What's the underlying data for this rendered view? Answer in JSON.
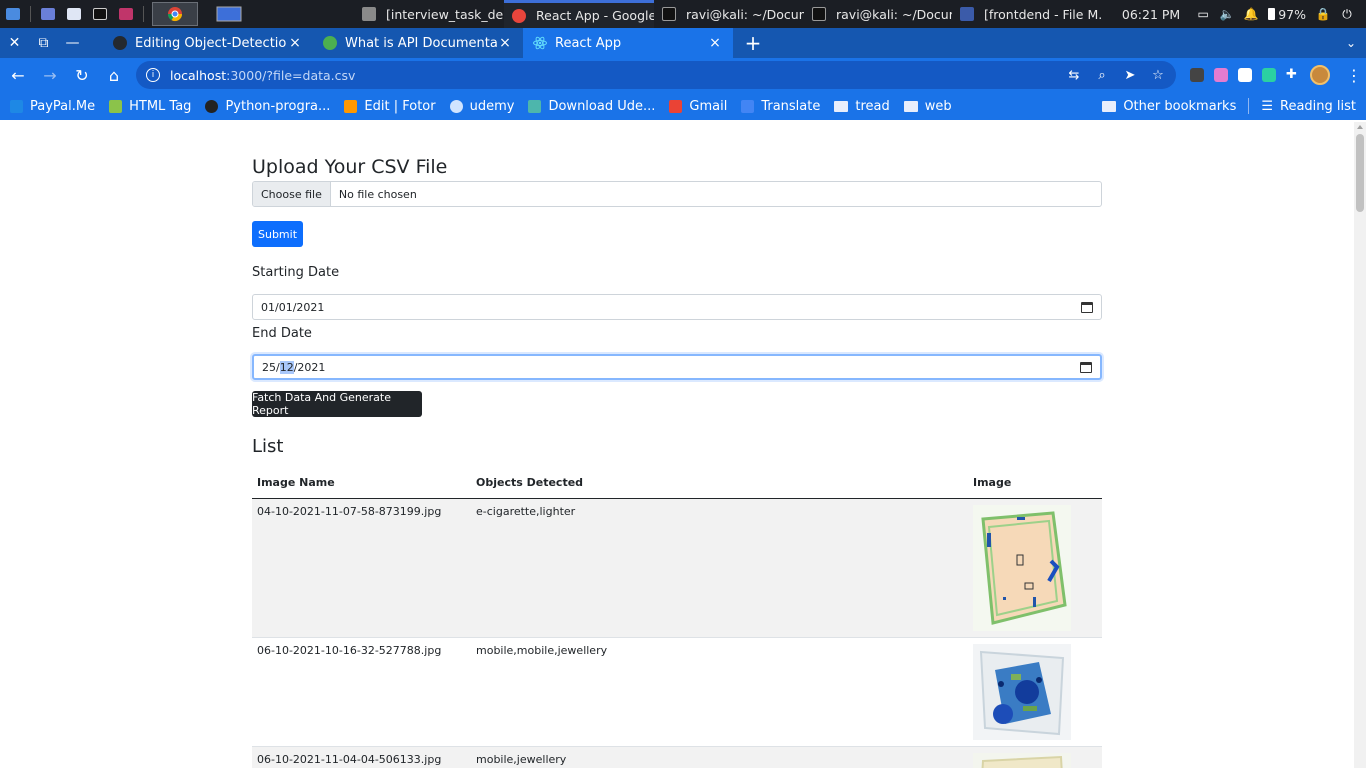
{
  "taskbar": {
    "tasks": [
      {
        "label": "[interview_task_de...",
        "color": "#8a8a8a"
      },
      {
        "label": "React App - Google...",
        "color": "#e8453c",
        "active": true
      },
      {
        "label": "ravi@kali: ~/Docum...",
        "color": "#333333"
      },
      {
        "label": "ravi@kali: ~/Docum...",
        "color": "#333333"
      },
      {
        "label": "[frontdend - File M...",
        "color": "#3b5ba9"
      }
    ],
    "time": "06:21 PM",
    "battery": "97%"
  },
  "browser": {
    "tabs": [
      {
        "label": "Editing Object-Detection/",
        "favicon_color": "#24292f",
        "close": "×"
      },
      {
        "label": "What is API Documentatio",
        "favicon_color": "#4caf50",
        "close": "×"
      },
      {
        "label": "React App",
        "favicon_color": "#61dafb",
        "close": "×",
        "active": true
      }
    ],
    "new_tab": "+",
    "url_host": "localhost",
    "url_rest": ":3000/?file=data.csv"
  },
  "bookmarks": {
    "items": [
      {
        "label": "PayPal.Me",
        "color": "#1e88e5"
      },
      {
        "label": "HTML Tag",
        "color": "#8bc34a"
      },
      {
        "label": "Python-progra...",
        "color": "#222222"
      },
      {
        "label": "Edit | Fotor",
        "color": "#ff9800"
      },
      {
        "label": "udemy",
        "color": "#d0e4ff"
      },
      {
        "label": "Download Ude...",
        "color": "#4db6ac"
      },
      {
        "label": "Gmail",
        "color": "#ea4335"
      },
      {
        "label": "Translate",
        "color": "#4285f4"
      },
      {
        "label": "tread",
        "folder": true
      },
      {
        "label": "web",
        "folder": true
      }
    ],
    "other": "Other bookmarks",
    "reading_list": "Reading list"
  },
  "page": {
    "upload_title": "Upload Your CSV File",
    "choose_file": "Choose file",
    "no_file": "No file chosen",
    "submit": "Submit",
    "start_label": "Starting Date",
    "start_value": "01/01/2021",
    "end_label": "End Date",
    "end_value_day": "25/",
    "end_value_month": "12",
    "end_value_year": "/2021",
    "fetch_button": "Fatch Data And Generate Report",
    "list_title": "List",
    "columns": [
      "Image Name",
      "Objects Detected",
      "Image"
    ],
    "rows": [
      {
        "name": "04-10-2021-11-07-58-873199.jpg",
        "objects": "e-cigarette,lighter"
      },
      {
        "name": "06-10-2021-10-16-32-527788.jpg",
        "objects": "mobile,mobile,jewellery"
      },
      {
        "name": "06-10-2021-11-04-04-506133.jpg",
        "objects": "mobile,jewellery"
      }
    ]
  },
  "colors": {
    "chrome_blue": "#1a73e8",
    "primary": "#0d6efd",
    "dark": "#212529"
  }
}
